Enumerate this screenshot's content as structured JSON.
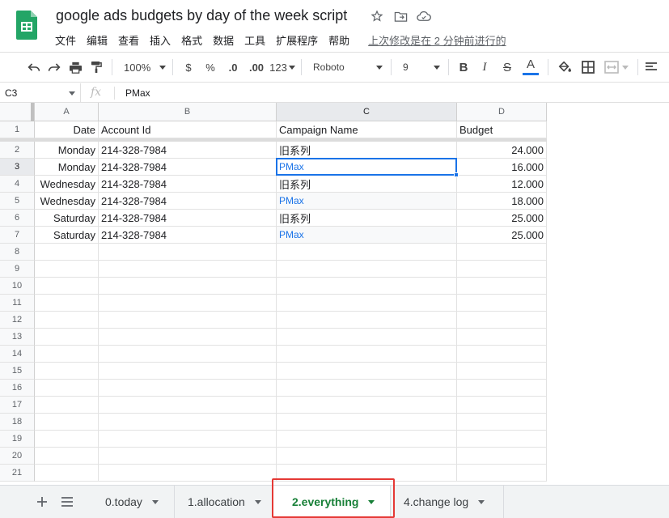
{
  "doc": {
    "title": "google ads budgets by day of the week script",
    "last_edit": "上次修改是在 2 分钟前进行的"
  },
  "menu": [
    "文件",
    "编辑",
    "查看",
    "插入",
    "格式",
    "数据",
    "工具",
    "扩展程序",
    "帮助"
  ],
  "toolbar": {
    "zoom": "100%",
    "currency": "$",
    "percent": "%",
    "dec_decrease": ".0",
    "dec_increase": ".00",
    "number_format": "123",
    "font": "Roboto",
    "font_size": "9",
    "bold": "B",
    "italic": "I",
    "strike": "S",
    "text_color_letter": "A",
    "text_color": "#1a73e8"
  },
  "formula_bar": {
    "cell_ref": "C3",
    "fx": "fx",
    "value": "PMax"
  },
  "columns": [
    "A",
    "B",
    "C",
    "D"
  ],
  "rows": [
    "1",
    "2",
    "3",
    "4",
    "5",
    "6",
    "7",
    "8",
    "9",
    "10",
    "11",
    "12",
    "13",
    "14",
    "15",
    "16",
    "17",
    "18",
    "19",
    "20",
    "21"
  ],
  "header_row": [
    "Date",
    "Account Id",
    "Campaign Name",
    "Budget"
  ],
  "data_rows": [
    [
      "Monday",
      "214-328-7984",
      "旧系列",
      "24.000"
    ],
    [
      "Monday",
      "214-328-7984",
      "PMax",
      "16.000"
    ],
    [
      "Wednesday",
      "214-328-7984",
      "旧系列",
      "12.000"
    ],
    [
      "Wednesday",
      "214-328-7984",
      "PMax",
      "18.000"
    ],
    [
      "Saturday",
      "214-328-7984",
      "旧系列",
      "25.000"
    ],
    [
      "Saturday",
      "214-328-7984",
      "PMax",
      "25.000"
    ]
  ],
  "sheet_tabs": [
    "0.today",
    "1.allocation",
    "2.everything",
    "4.change log"
  ],
  "active_tab": "2.everything",
  "colors": {
    "accent_blue": "#1a73e8",
    "sheets_green": "#188038",
    "highlight_red": "#e53935"
  }
}
